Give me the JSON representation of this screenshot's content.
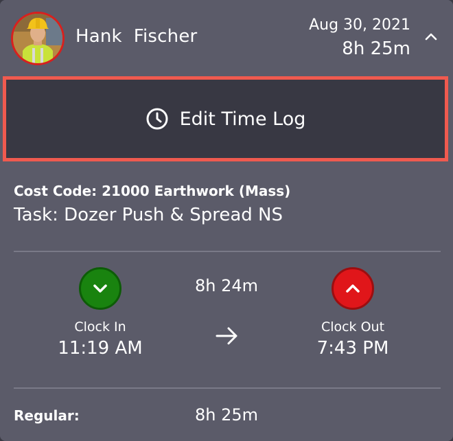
{
  "header": {
    "name": "Hank  Fischer",
    "date": "Aug 30, 2021",
    "duration": "8h 25m",
    "collapse_icon": "chevron-up-icon",
    "avatar_icon": "worker-photo"
  },
  "edit_button": {
    "label": "Edit Time Log",
    "icon": "clock-icon",
    "highlight_color": "#f05a4f"
  },
  "details": {
    "cost_code": "Cost Code: 21000 Earthwork (Mass)",
    "task": "Task: Dozer Push & Spread NS"
  },
  "clock": {
    "in_label": "Clock In",
    "in_time": "11:19 AM",
    "in_color": "#19830f",
    "out_label": "Clock Out",
    "out_time": "7:43 PM",
    "out_color": "#e0161a",
    "elapsed": "8h 24m"
  },
  "summary": {
    "regular_label": "Regular:",
    "regular_value": "8h 25m"
  }
}
